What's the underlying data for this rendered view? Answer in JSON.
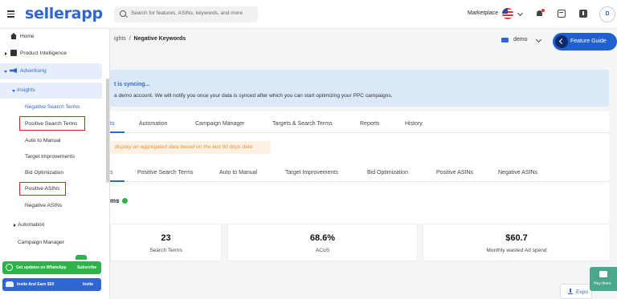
{
  "topbar": {
    "logo": "sellerapp",
    "search_placeholder": "Search for features, ASINs, keywords, and more",
    "marketplace_label": "Marketplace",
    "avatar_initial": "D"
  },
  "sidebar": {
    "items": [
      {
        "label": "Home"
      },
      {
        "label": "Product Intelligence"
      },
      {
        "label": "Advertising"
      },
      {
        "label": "Insights"
      },
      {
        "label": "Negative Search Terms"
      },
      {
        "label": "Positive Search Terms"
      },
      {
        "label": "Auto to Manual"
      },
      {
        "label": "Target Improvements"
      },
      {
        "label": "Bid Optimization"
      },
      {
        "label": "Positive ASINs"
      },
      {
        "label": "Negative ASINs"
      },
      {
        "label": "Automation"
      },
      {
        "label": "Campaign Manager"
      }
    ],
    "whatsapp": {
      "text": "Get updates on WhatsApp",
      "action": "Subscribe"
    },
    "invite": {
      "text": "Invite And Earn $50",
      "action": "Invite"
    }
  },
  "main": {
    "breadcrumb_prefix": "ights",
    "breadcrumb_sep": "/",
    "breadcrumb_current": "Negative Keywords",
    "account": "demo",
    "feature_guide": "Feature Guide",
    "sync_title": "t is syncing...",
    "sync_text": "a demo account. We will notify you once your data is synced after which you can start optimizing your PPC campaigns.",
    "tabs1": [
      "ts",
      "Automation",
      "Campaign Manager",
      "Targets & Search Terms",
      "Reports",
      "History"
    ],
    "notice": "display an aggregated data based on the last 60 days data",
    "tabs2": [
      "s",
      "Positive Search Terms",
      "Auto to Manual",
      "Target Improvements",
      "Bid Optimization",
      "Positive ASINs",
      "Negative ASINs"
    ],
    "section_title": "ms",
    "stats": [
      {
        "value": "23",
        "label": "Search Terms"
      },
      {
        "value": "68.6%",
        "label": "ACoS"
      },
      {
        "value": "$60.7",
        "label": "Monthly wasted Ad spend"
      }
    ],
    "export": "Expo",
    "chat_widget": "Hey there"
  }
}
